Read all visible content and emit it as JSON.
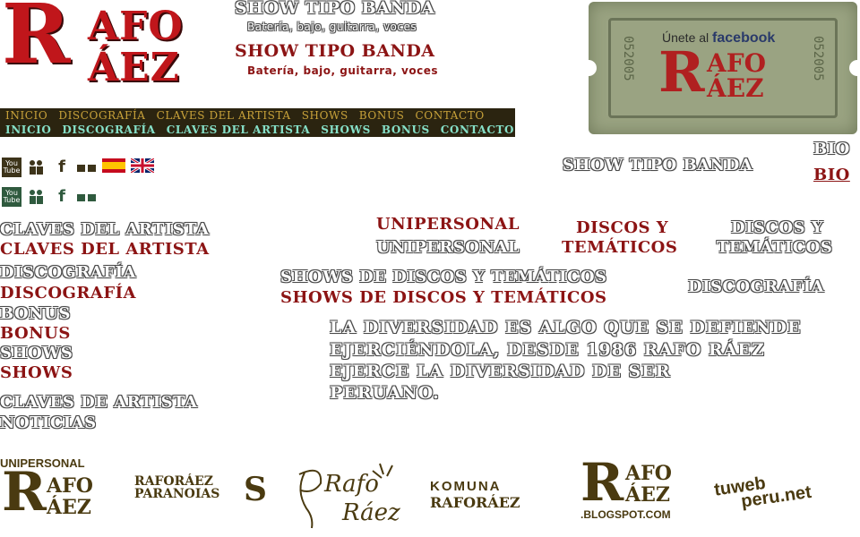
{
  "logo": {
    "r": "R",
    "afo": "AFO",
    "aez": "ÁEZ"
  },
  "header": {
    "ghost_title": "SHOW TIPO BANDA",
    "ghost_sub": "Batería, bajo, guitarra, voces",
    "title": "SHOW TIPO BANDA",
    "sub": "Batería, bajo, guitarra, voces"
  },
  "nav": {
    "items": [
      "INICIO",
      "DISCOGRAFÍA",
      "CLAVES DEL ARTISTA",
      "SHOWS",
      "BONUS",
      "CONTACTO"
    ]
  },
  "ticket": {
    "join_text": "Únete al",
    "brand": "facebook",
    "serial": "052005",
    "r": "R",
    "afo": "AFO",
    "aez": "ÁEZ"
  },
  "icons": {
    "youtube_line1": "You",
    "youtube_line2": "Tube",
    "myspace": "",
    "facebook": "f"
  },
  "right_links": {
    "show_tipo_banda": "SHOW TIPO BANDA",
    "bio_ghost": "BIO",
    "bio": "BIO"
  },
  "left_menu": {
    "claves_ghost": "CLAVES DEL ARTISTA",
    "claves": "CLAVES DEL ARTISTA",
    "disco_ghost": "DISCOGRAFÍA",
    "disco": "DISCOGRAFÍA",
    "bonus_ghost": "BONUS",
    "bonus": "BONUS",
    "shows_ghost": "SHOWS",
    "shows": "SHOWS",
    "claves_de": "CLAVES DE ARTISTA",
    "noticias": "NOTICIAS"
  },
  "center": {
    "unipersonal_red": "UNIPERSONAL",
    "unipersonal_ghost": "UNIPERSONAL",
    "discos_red_1": "DISCOS Y",
    "discos_red_2": "TEMÁTICOS",
    "discos_ghost_1": "DISCOS Y",
    "discos_ghost_2": "TEMÁTICOS",
    "shows_discos_ghost": "SHOWS DE DISCOS Y TEMÁTICOS",
    "shows_discos_red": "SHOWS DE DISCOS Y TEMÁTICOS",
    "discografia_ghost": "DISCOGRAFÍA",
    "para1": "LA DIVERSIDAD ES ALGO QUE SE  DEFIENDE",
    "para2": "EJERCIÉNDOLA, DESDE 1986 RAFO RÁEZ",
    "para3": "EJERCE LA   DIVERSIDAD DE SER",
    "para4": "PERUANO."
  },
  "footer": {
    "unipersonal": "UNIPERSONAL",
    "rafo_r": "R",
    "rafo_afo": "AFO",
    "rafo_aez": "ÁEZ",
    "paranoias_1": "RAFORÁEZ",
    "paranoias_2": "PARANOIAS",
    "sig_1": "Rafo",
    "sig_2": "Ráez",
    "komuna_1": "KOMUNA",
    "komuna_2": "RAFORÁEZ",
    "blog_r": "R",
    "blog_afo": "AFO",
    "blog_aez": "ÁEZ",
    "blogspot": ".BLOGSPOT.COM",
    "tuweb_1": "tuweb",
    "tuweb_2": "peru.net"
  }
}
